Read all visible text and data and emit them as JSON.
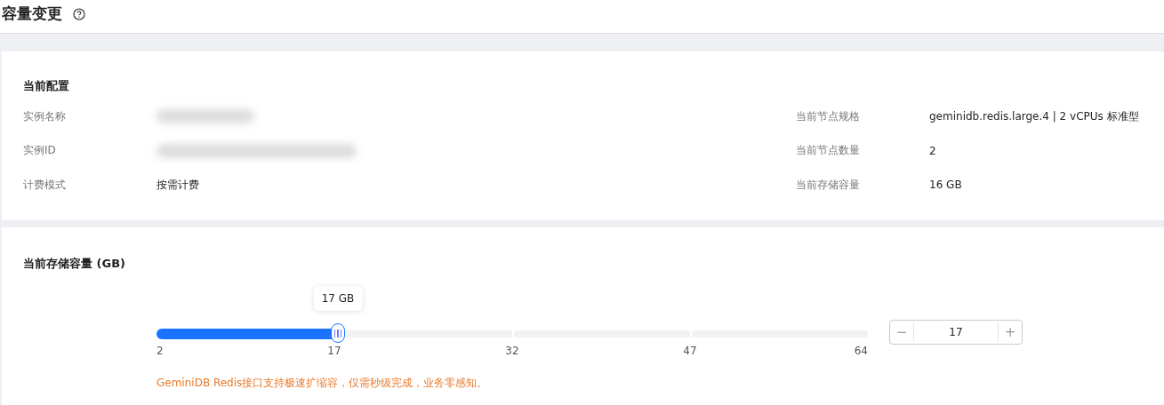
{
  "page": {
    "title": "容量变更"
  },
  "current_config": {
    "heading": "当前配置",
    "left": [
      {
        "label": "实例名称",
        "redacted": true
      },
      {
        "label": "实例ID",
        "redacted": true
      },
      {
        "label": "计费模式",
        "value": "按需计费",
        "redacted": false
      }
    ],
    "right": [
      {
        "label": "当前节点规格",
        "value": "geminidb.redis.large.4 | 2 vCPUs 标准型"
      },
      {
        "label": "当前节点数量",
        "value": "2"
      },
      {
        "label": "当前存储容量",
        "value": "16 GB"
      }
    ]
  },
  "storage": {
    "heading": "当前存储容量 (GB)",
    "tooltip": "17 GB",
    "level": 0.255,
    "ticks": [
      "2",
      "17",
      "32",
      "47",
      "64"
    ],
    "stepper": {
      "decrement": "−",
      "value": "17",
      "increment": "+"
    },
    "note": "GeminiDB Redis接口支持极速扩缩容，仅需秒级完成，业务零感知。"
  }
}
